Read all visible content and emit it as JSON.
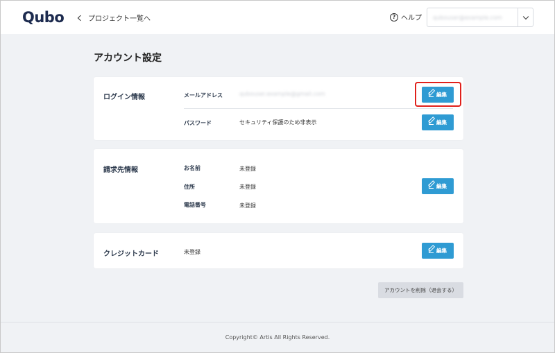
{
  "header": {
    "logo": "Qubo",
    "back_label": "プロジェクト一覧へ",
    "help_label": "ヘルプ",
    "user_email": "qubouser@example.com"
  },
  "page_title": "アカウント設定",
  "login_section": {
    "title": "ログイン情報",
    "email_label": "メールアドレス",
    "email_value": "qubouser.example@gmail.com",
    "password_label": "パスワード",
    "password_value": "セキュリティ保護のため非表示"
  },
  "billing_section": {
    "title": "請求先情報",
    "name_label": "お名前",
    "name_value": "未登録",
    "address_label": "住所",
    "address_value": "未登録",
    "phone_label": "電話番号",
    "phone_value": "未登録"
  },
  "credit_section": {
    "title": "クレジットカード",
    "value": "未登録"
  },
  "edit_label": "編集",
  "delete_label": "アカウントを削除（退会する）",
  "footer": "Copyright© Artis All Rights Reserved.",
  "colors": {
    "primary": "#2f9bd3",
    "highlight": "#e0201b",
    "background": "#f0f2f5"
  }
}
